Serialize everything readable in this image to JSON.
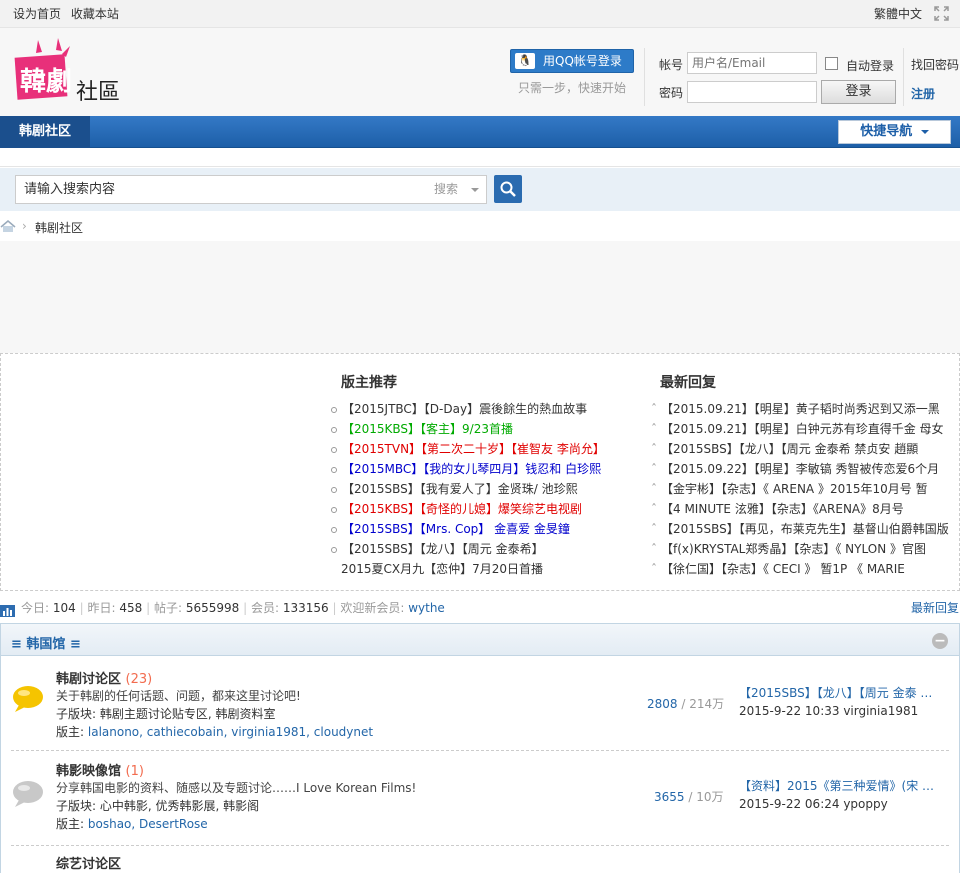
{
  "topbar": {
    "set_home": "设为首页",
    "bookmark": "收藏本站",
    "traditional": "繁體中文"
  },
  "header": {
    "logo_alt": "韩剧社区",
    "qq_login": "用QQ帐号登录",
    "qq_hint": "只需一步，快速开始",
    "account_label": "帐号",
    "account_placeholder": "用户名/Email",
    "password_label": "密码",
    "auto_login": "自动登录",
    "login_button": "登录",
    "find_password": "找回密码",
    "register": "注册"
  },
  "nav": {
    "item": "韩剧社区",
    "quick_nav": "快捷导航"
  },
  "search": {
    "placeholder": "请输入搜索内容",
    "select": "搜索"
  },
  "breadcrumb": {
    "current": "韩剧社区"
  },
  "recommend": {
    "title": "版主推荐",
    "items": [
      {
        "text": "【2015JTBC】【D-Day】震後餘生的熱血故事",
        "color": "#333333"
      },
      {
        "text": "【2015KBS】【客主】9/23首播",
        "color": "#00aa00"
      },
      {
        "text": "【2015TVN】【第二次二十岁】【崔智友 李尚允】",
        "color": "#e00000"
      },
      {
        "text": "【2015MBC】【我的女儿琴四月】钱忍和 白珍熙",
        "color": "#0000cc"
      },
      {
        "text": "【2015SBS】【我有爱人了】金贤珠/ 池珍熙",
        "color": "#333333"
      },
      {
        "text": "【2015KBS】【奇怪的儿媳】爆笑综艺电视剧",
        "color": "#e00000"
      },
      {
        "text": "【2015SBS】【Mrs. Cop】 金喜爱 金旻鐘",
        "color": "#0000cc"
      },
      {
        "text": "【2015SBS】【龙八】【周元 金泰希】",
        "color": "#333333"
      },
      {
        "text": "2015夏CX月九【恋仲】7月20日首播",
        "color": "#333333",
        "nodot": true
      }
    ]
  },
  "replies": {
    "title": "最新回复",
    "items": [
      "【2015.09.21】【明星】黄子韬时尚秀迟到又添一黑",
      "【2015.09.21】【明星】白钟元苏有珍直得千金 母女",
      "【2015SBS】【龙八】【周元 金泰希 禁贞安 趙顯",
      "【2015.09.22】【明星】李敏镐 秀智被传恋爱6个月",
      "【金宇彬】【杂志】《 ARENA 》2015年10月号 暂",
      "【4 MINUTE 泫雅】【杂志】《ARENA》8月号",
      "【2015SBS】【再见，布莱克先生】基督山伯爵韩国版",
      "【f(x)KRYSTAL郑秀晶】【杂志】《 NYLON 》官图",
      "【徐仁国】【杂志】《 CECI 》 暂1P 《 MARIE"
    ]
  },
  "stats": {
    "today_label": "今日:",
    "today": "104",
    "yesterday_label": "昨日:",
    "yesterday": "458",
    "posts_label": "帖子:",
    "posts": "5655998",
    "members_label": "会员:",
    "members": "133156",
    "welcome_label": "欢迎新会员:",
    "newest": "wythe",
    "latest_reply": "最新回复"
  },
  "forum_group": {
    "title": "韩国馆",
    "forums": [
      {
        "name": "韩剧讨论区",
        "count": "(23)",
        "desc": "关于韩剧的任何话题、问题，都来这里讨论吧!",
        "sub_label": "子版块:",
        "subs": "韩剧主题讨论贴专区, 韩剧资料室",
        "mod_label": "版主:",
        "mods": "lalanono, cathiecobain, virginia1981, cloudynet",
        "threads": "2808",
        "posts": "214万",
        "last_title": "【2015SBS】【龙八】【周元 金泰 …",
        "last_meta": "2015-9-22 10:33 virginia1981",
        "icon_color": "#f5c400"
      },
      {
        "name": "韩影映像馆",
        "count": "(1)",
        "desc": "分享韩国电影的资料、随感以及专题讨论……I Love Korean Films!",
        "sub_label": "子版块:",
        "subs": "心中韩影, 优秀韩影展, 韩影阁",
        "mod_label": "版主:",
        "mods": "boshao, DesertRose",
        "threads": "3655",
        "posts": "10万",
        "last_title": "【资料】2015《第三种爱情》(宋 …",
        "last_meta": "2015-9-22 06:24 ypoppy",
        "icon_color": "#c8c8c8"
      },
      {
        "name": "综艺讨论区"
      }
    ]
  }
}
